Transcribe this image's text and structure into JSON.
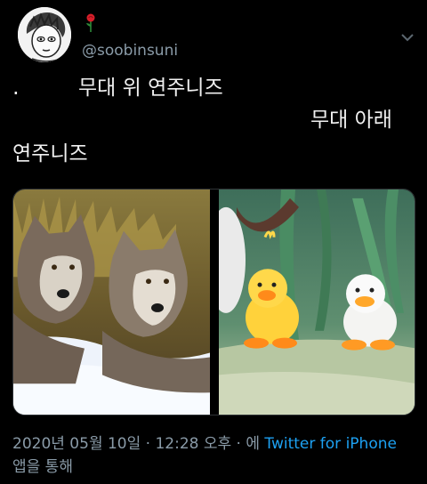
{
  "user": {
    "handle": "@soobinsuni",
    "avatar_icon": "cartoon-avatar",
    "badge_icon": "rose-icon"
  },
  "tweet": {
    "dot": ".",
    "line1": "무대 위 연주니즈",
    "line2": "무대 아래",
    "line3": "연주니즈"
  },
  "media": {
    "left_image": "wolves-in-snow",
    "right_image": "two-toy-ducks"
  },
  "meta": {
    "timestamp": "2020년 05월 10일 · 12:28 오후 · 에",
    "client_link": "Twitter for iPhone",
    "suffix": "앱을 통해"
  },
  "colors": {
    "background": "#000000",
    "secondary_text": "#8a9ba8",
    "link": "#1da1f2"
  }
}
